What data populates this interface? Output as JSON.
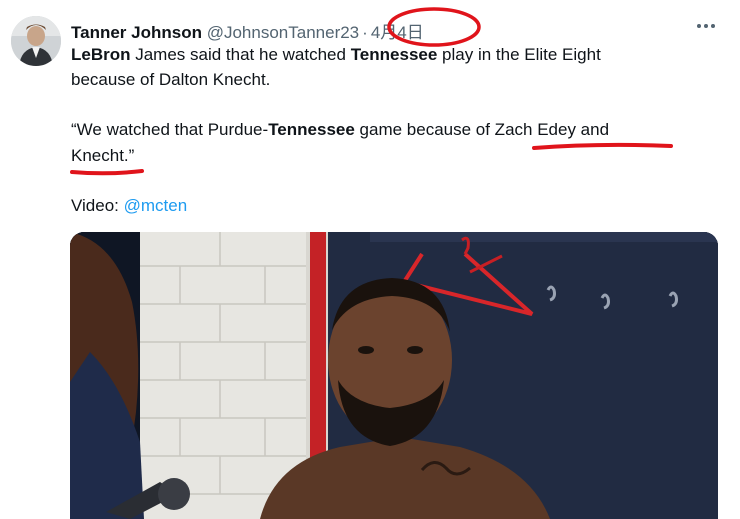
{
  "tweet": {
    "display_name": "Tanner Johnson",
    "handle": "@JohnsonTanner23",
    "separator": "·",
    "date": "4月4日",
    "line1": {
      "b1": "LeBron",
      "t1": " James said that he watched ",
      "b2": "Tennessee",
      "t2": " play in the Elite Eight"
    },
    "line2": "because of Dalton Knecht.",
    "quote1": {
      "t1": "“We watched that Purdue-",
      "b1": "Tennessee",
      "t2": " game because of Zach Edey and"
    },
    "quote2": "Knecht.”",
    "video": {
      "label": "Video: ",
      "link": "@mcten"
    }
  },
  "icons": {
    "avatar": "profile-photo",
    "more": "more-options-icon",
    "media": "video-thumbnail"
  },
  "colors": {
    "link": "#1d9bf0",
    "annotation": "#e0141b",
    "secondary": "#536471"
  }
}
